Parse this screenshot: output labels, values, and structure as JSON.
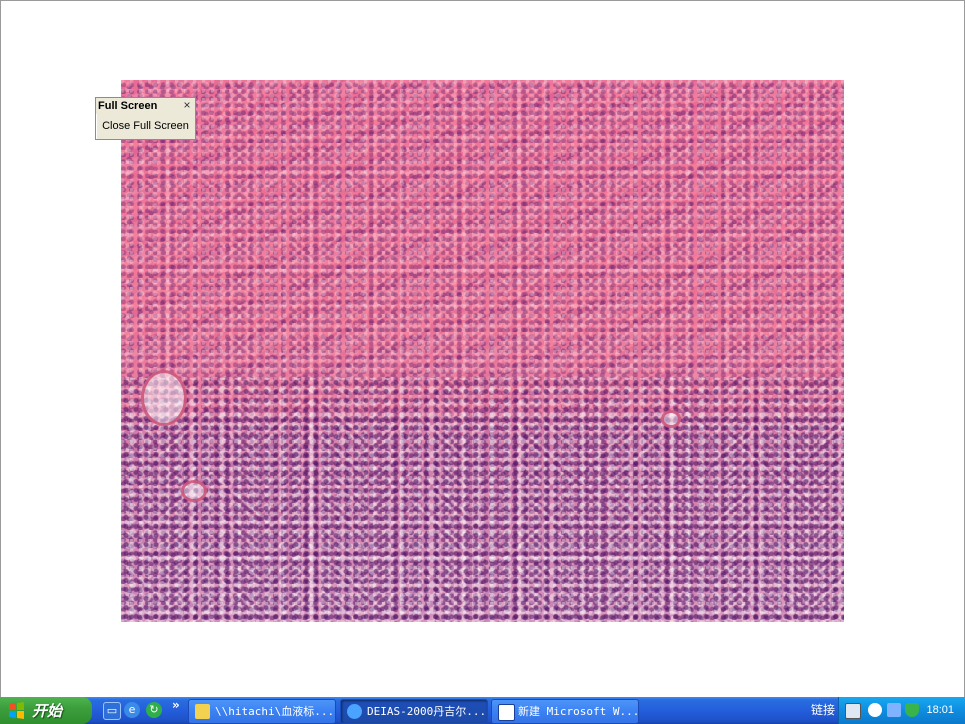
{
  "fullscreen_toolbar": {
    "title": "Full Screen",
    "close_glyph": "×",
    "close_label": "Close Full Screen"
  },
  "taskbar": {
    "start_label": "开始",
    "quick_launch_chevron": "»",
    "quick_launch_icons": [
      "desktop-icon",
      "internet-explorer-icon",
      "refresh-icon"
    ],
    "tasks": [
      {
        "label": "\\\\hitachi\\血液标...",
        "icon": "folder-icon"
      },
      {
        "label": "DEIAS-2000丹吉尔...",
        "icon": "app-icon"
      },
      {
        "label": "新建 Microsoft W...",
        "icon": "word-icon"
      }
    ],
    "links_label": "链接",
    "tray_icons": [
      "keyboard-icon",
      "chevron-left-icon",
      "network-icon",
      "shield-icon"
    ],
    "clock": "18:01"
  },
  "colors": {
    "taskbar_blue": "#245edb",
    "start_green": "#3c9f3c",
    "tray_blue": "#0f8de0",
    "stain_pink": "#e36f97"
  }
}
